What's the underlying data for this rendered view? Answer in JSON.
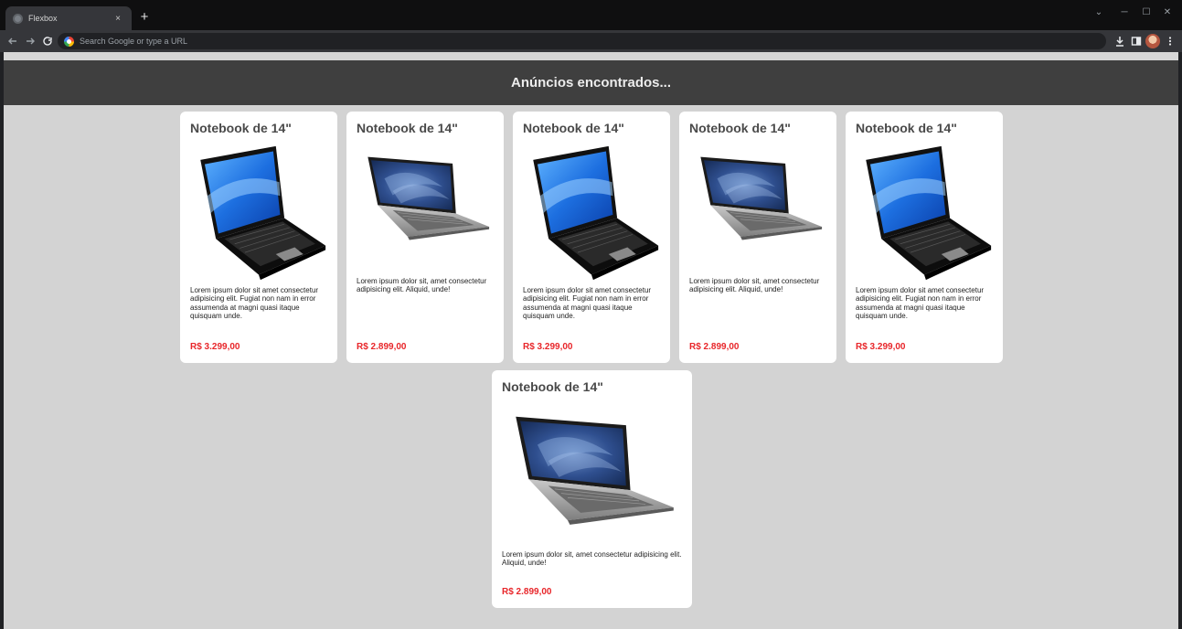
{
  "browser": {
    "tab_title": "Flexbox",
    "tab_close": "×",
    "new_tab": "+",
    "omnibox_placeholder": "Search Google or type a URL",
    "window_controls": [
      "⌄",
      "─",
      "☐",
      "✕"
    ],
    "icons": [
      "back-icon",
      "forward-icon",
      "reload-icon",
      "download-icon",
      "sidepanel-icon",
      "profile-avatar",
      "menu-icon"
    ]
  },
  "page": {
    "header_title": "Anúncios encontrados...",
    "price_color": "#e8262a",
    "header_bg": "#3f3f3f",
    "page_bg": "#d3d3d3"
  },
  "cards": [
    {
      "title": "Notebook de 14\"",
      "image": "laptop-black-icon",
      "description": "Lorem ipsum dolor sit amet consectetur adipisicing elit. Fugiat non nam in error assumenda at magni quasi itaque quisquam unde.",
      "price": "R$ 3.299,00"
    },
    {
      "title": "Notebook de 14\"",
      "image": "laptop-silver-icon",
      "description": "Lorem ipsum dolor sit, amet consectetur adipisicing elit. Aliquid, unde!",
      "price": "R$ 2.899,00"
    },
    {
      "title": "Notebook de 14\"",
      "image": "laptop-black-icon",
      "description": "Lorem ipsum dolor sit amet consectetur adipisicing elit. Fugiat non nam in error assumenda at magni quasi itaque quisquam unde.",
      "price": "R$ 3.299,00"
    },
    {
      "title": "Notebook de 14\"",
      "image": "laptop-silver-icon",
      "description": "Lorem ipsum dolor sit, amet consectetur adipisicing elit. Aliquid, unde!",
      "price": "R$ 2.899,00"
    },
    {
      "title": "Notebook de 14\"",
      "image": "laptop-black-icon",
      "description": "Lorem ipsum dolor sit amet consectetur adipisicing elit. Fugiat non nam in error assumenda at magni quasi itaque quisquam unde.",
      "price": "R$ 3.299,00"
    },
    {
      "title": "Notebook de 14\"",
      "image": "laptop-silver-icon",
      "description": "Lorem ipsum dolor sit, amet consectetur adipisicing elit. Aliquid, unde!",
      "price": "R$ 2.899,00"
    }
  ]
}
